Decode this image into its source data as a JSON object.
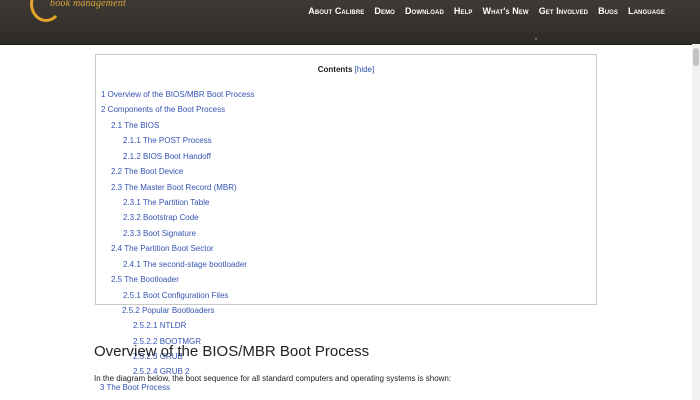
{
  "brand": {
    "tagline": "book management"
  },
  "nav": [
    {
      "label": "About Calibre"
    },
    {
      "label": "Demo"
    },
    {
      "label": "Download"
    },
    {
      "label": "Help"
    },
    {
      "label": "What's New"
    },
    {
      "label": "Get Involved"
    },
    {
      "label": "Bugs"
    },
    {
      "label": "Language"
    }
  ],
  "toc": {
    "title": "Contents",
    "hide": "[hide]",
    "entries": [
      {
        "label": "1 Overview of the BIOS/MBR Boot Process"
      },
      {
        "label": "2 Components of the Boot Process"
      },
      {
        "label": "2.1 The BIOS"
      },
      {
        "label": "2.1.1 The POST Process"
      },
      {
        "label": "2.1.2 BIOS Boot Handoff"
      },
      {
        "label": "2.2 The Boot Device"
      },
      {
        "label": "2.3 The Master Boot Record (MBR)"
      },
      {
        "label": "2.3.1 The Partition Table"
      },
      {
        "label": "2.3.2 Bootstrap Code"
      },
      {
        "label": "2.3.3 Boot Signature"
      },
      {
        "label": "2.4 The Partition Boot Sector"
      },
      {
        "label": "2.4.1 The second-stage bootloader"
      },
      {
        "label": "2.5 The Bootloader"
      },
      {
        "label": "2.5.1 Boot Configuration Files"
      },
      {
        "label": "2.5.2 Popular Bootloaders"
      },
      {
        "label": "2.5.2.1 NTLDR"
      },
      {
        "label": "2.5.2.2 BOOTMGR"
      },
      {
        "label": "2.5.2.3 GRUB"
      },
      {
        "label": "2.5.2.4 GRUB 2"
      },
      {
        "label": "3 The Boot Process"
      }
    ]
  },
  "main": {
    "heading": "Overview of the BIOS/MBR Boot Process",
    "intro": "In the diagram below, the boot sequence for all standard computers and operating systems is shown:"
  }
}
